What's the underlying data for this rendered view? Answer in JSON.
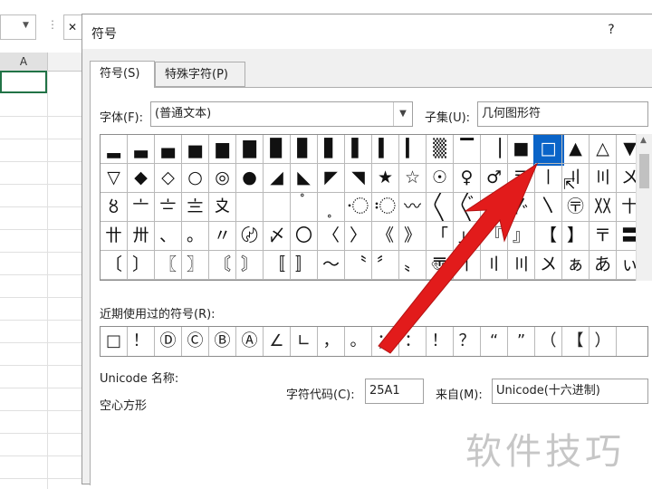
{
  "sheet": {
    "column_a": "A",
    "fx_label": "✕"
  },
  "dialog": {
    "title": "符号",
    "help": "?",
    "tabs": [
      {
        "label": "符号(S)"
      },
      {
        "label": "特殊字符(P)"
      }
    ],
    "font_label": "字体(F):",
    "font_value": "(普通文本)",
    "subset_label": "子集(U):",
    "subset_value": "几何图形符",
    "symbols": [
      [
        "▂",
        "▃",
        "▄",
        "▅",
        "▆",
        "▇",
        "▉",
        "▊",
        "▋",
        "▌",
        "▍",
        "▎",
        "▒",
        "▔",
        "▕",
        "■",
        "□",
        "▲",
        "△",
        "▼"
      ],
      [
        "▽",
        "◆",
        "◇",
        "○",
        "◎",
        "●",
        "◢",
        "◣",
        "◤",
        "◥",
        "★",
        "☆",
        "☉",
        "♀",
        "♂",
        "〒",
        "〡",
        "〢",
        "〣",
        "〤"
      ],
      [
        "〥",
        "〦",
        "〧",
        "〨",
        "〩",
        "〪",
        "〫",
        "〬",
        "〭",
        "〮",
        "〯",
        "〰",
        "〱",
        "〲",
        "〳",
        "〴",
        "〵",
        "〶",
        "〷",
        "〸"
      ],
      [
        "〹",
        "〺",
        "、",
        "。",
        "〃",
        "〄",
        "〆",
        "〇",
        "〈",
        "〉",
        "《",
        "》",
        "「",
        "」",
        "『",
        "』",
        "【",
        "】",
        "〒",
        "〓"
      ],
      [
        "〔",
        "〕",
        "〖",
        "〗",
        "〘",
        "〙",
        "〚",
        "〛",
        "〜",
        "〝",
        "〞",
        "〟",
        "〠",
        "〡",
        "〢",
        "〣",
        "〤",
        "ぁ",
        "あ",
        "ぃ"
      ]
    ],
    "selected_row": 0,
    "selected_col": 16,
    "recent_label": "近期使用过的符号(R):",
    "recent_symbols": [
      "□",
      "！",
      "Ⓓ",
      "Ⓒ",
      "Ⓑ",
      "Ⓐ",
      "∠",
      "∟",
      "，",
      "。",
      "；",
      "：",
      "！",
      "？",
      "“",
      "”",
      "（",
      "【",
      "）"
    ],
    "unicode_name_label": "Unicode 名称:",
    "unicode_name_value": "空心方形",
    "char_code_label": "字符代码(C):",
    "char_code_value": "25A1",
    "from_label": "来自(M):",
    "from_value": "Unicode(十六进制)"
  },
  "watermark": {
    "text": "软件技巧"
  },
  "colors": {
    "selection": "#0a64c8",
    "arrow": "#e21b1b",
    "excel_green": "#217346"
  }
}
